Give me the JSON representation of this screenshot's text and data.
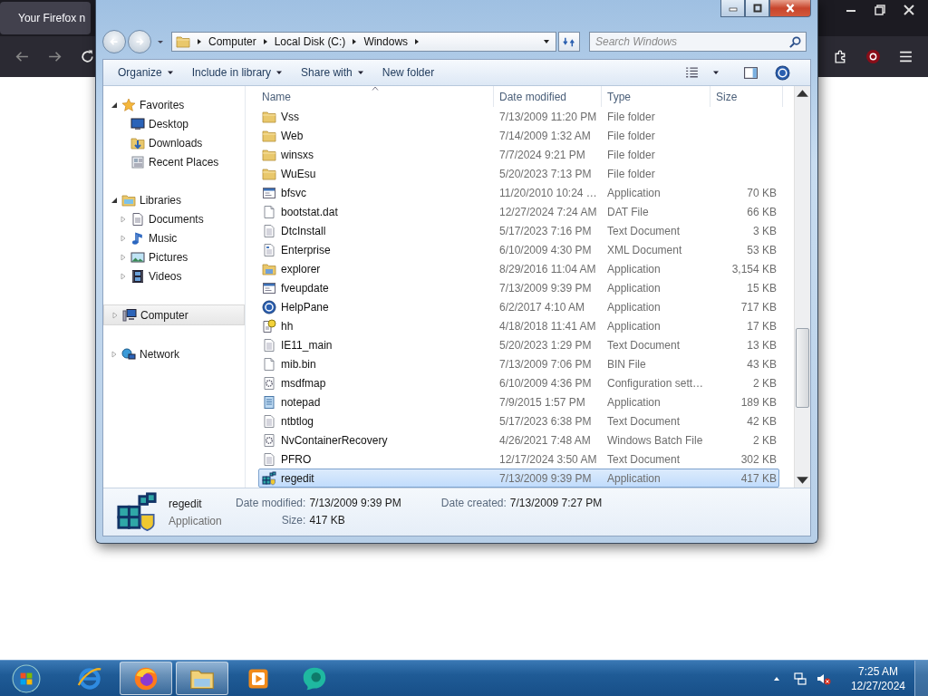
{
  "browser": {
    "tab_title": "Your Firefox n"
  },
  "explorer": {
    "breadcrumb": [
      "Computer",
      "Local Disk (C:)",
      "Windows"
    ],
    "search": {
      "placeholder": "Search Windows"
    },
    "commands": [
      {
        "label": "Organize",
        "dropdown": true
      },
      {
        "label": "Include in library",
        "dropdown": true
      },
      {
        "label": "Share with",
        "dropdown": true
      },
      {
        "label": "New folder",
        "dropdown": false
      }
    ],
    "nav": [
      {
        "label": "Favorites",
        "kind": "star",
        "expanded": true,
        "selected": false,
        "children": [
          {
            "label": "Desktop",
            "kind": "monitor",
            "selected": false
          },
          {
            "label": "Downloads",
            "kind": "downloads",
            "selected": false
          },
          {
            "label": "Recent Places",
            "kind": "recent",
            "selected": false
          }
        ]
      },
      {
        "label": "Libraries",
        "kind": "library",
        "expanded": true,
        "selected": false,
        "children": [
          {
            "label": "Documents",
            "kind": "document",
            "expanded": false,
            "selected": false
          },
          {
            "label": "Music",
            "kind": "music",
            "expanded": false,
            "selected": false
          },
          {
            "label": "Pictures",
            "kind": "pictures",
            "expanded": false,
            "selected": false
          },
          {
            "label": "Videos",
            "kind": "film",
            "expanded": false,
            "selected": false
          }
        ]
      },
      {
        "label": "Computer",
        "kind": "computer",
        "expanded": false,
        "selected": true
      },
      {
        "label": "Network",
        "kind": "network",
        "expanded": false,
        "selected": false
      }
    ],
    "columns": [
      "Name",
      "Date modified",
      "Type",
      "Size"
    ],
    "rows": [
      {
        "name": "Vss",
        "date": "7/13/2009 11:20 PM",
        "type": "File folder",
        "kind": "folder",
        "selected": false
      },
      {
        "name": "Web",
        "date": "7/14/2009 1:32 AM",
        "type": "File folder",
        "kind": "folder",
        "selected": false
      },
      {
        "name": "winsxs",
        "date": "7/7/2024 9:21 PM",
        "type": "File folder",
        "kind": "folder",
        "selected": false
      },
      {
        "name": "WuEsu",
        "date": "5/20/2023 7:13 PM",
        "type": "File folder",
        "kind": "folder",
        "selected": false
      },
      {
        "name": "bfsvc",
        "date": "11/20/2010 10:24 …",
        "type": "Application",
        "size": "70 KB",
        "kind": "window",
        "selected": false
      },
      {
        "name": "bootstat.dat",
        "date": "12/27/2024 7:24 AM",
        "type": "DAT File",
        "size": "66 KB",
        "kind": "page",
        "selected": false
      },
      {
        "name": "DtcInstall",
        "date": "5/17/2023 7:16 PM",
        "type": "Text Document",
        "size": "3 KB",
        "kind": "text",
        "selected": false
      },
      {
        "name": "Enterprise",
        "date": "6/10/2009 4:30 PM",
        "type": "XML Document",
        "size": "53 KB",
        "kind": "xml",
        "selected": false
      },
      {
        "name": "explorer",
        "date": "8/29/2016 11:04 AM",
        "type": "Application",
        "size": "3,154 KB",
        "kind": "explorer",
        "selected": false
      },
      {
        "name": "fveupdate",
        "date": "7/13/2009 9:39 PM",
        "type": "Application",
        "size": "15 KB",
        "kind": "window",
        "selected": false
      },
      {
        "name": "HelpPane",
        "date": "6/2/2017 4:10 AM",
        "type": "Application",
        "size": "717 KB",
        "kind": "help",
        "selected": false
      },
      {
        "name": "hh",
        "date": "4/18/2018 11:41 AM",
        "type": "Application",
        "size": "17 KB",
        "kind": "hh",
        "selected": false
      },
      {
        "name": "IE11_main",
        "date": "5/20/2023 1:29 PM",
        "type": "Text Document",
        "size": "13 KB",
        "kind": "text",
        "selected": false
      },
      {
        "name": "mib.bin",
        "date": "7/13/2009 7:06 PM",
        "type": "BIN File",
        "size": "43 KB",
        "kind": "page",
        "selected": false
      },
      {
        "name": "msdfmap",
        "date": "6/10/2009 4:36 PM",
        "type": "Configuration sett…",
        "size": "2 KB",
        "kind": "gear",
        "selected": false
      },
      {
        "name": "notepad",
        "date": "7/9/2015 1:57 PM",
        "type": "Application",
        "size": "189 KB",
        "kind": "notepad",
        "selected": false
      },
      {
        "name": "ntbtlog",
        "date": "5/17/2023 6:38 PM",
        "type": "Text Document",
        "size": "42 KB",
        "kind": "text",
        "selected": false
      },
      {
        "name": "NvContainerRecovery",
        "date": "4/26/2021 7:48 AM",
        "type": "Windows Batch File",
        "size": "2 KB",
        "kind": "gear",
        "selected": false
      },
      {
        "name": "PFRO",
        "date": "12/17/2024 3:50 AM",
        "type": "Text Document",
        "size": "302 KB",
        "kind": "text",
        "selected": false
      },
      {
        "name": "regedit",
        "date": "7/13/2009 9:39 PM",
        "type": "Application",
        "size": "417 KB",
        "kind": "cubes",
        "selected": true
      }
    ],
    "details": {
      "name": "regedit",
      "type": "Application",
      "kind": "cubes",
      "field_columns": [
        [
          {
            "label": "Date modified:",
            "value": "7/13/2009 9:39 PM"
          },
          {
            "label": "Size:",
            "value": "417 KB"
          }
        ],
        [
          {
            "label": "Date created:",
            "value": "7/13/2009 7:27 PM"
          }
        ]
      ]
    }
  },
  "taskbar": {
    "apps": [
      {
        "kind": "ie",
        "active": false
      },
      {
        "kind": "firefox",
        "active": true
      },
      {
        "kind": "folder",
        "active": true
      },
      {
        "kind": "media",
        "active": false
      },
      {
        "kind": "teal",
        "active": false
      }
    ],
    "time": "7:25 AM",
    "date": "12/27/2024"
  }
}
